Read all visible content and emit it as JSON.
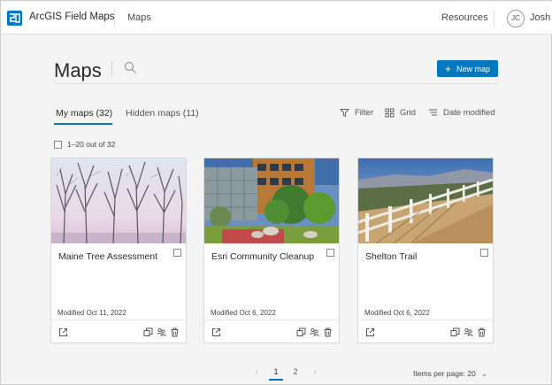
{
  "header": {
    "app_title": "ArcGIS Field Maps",
    "nav_maps": "Maps",
    "resources": "Resources",
    "avatar_initials": "JC",
    "username": "Josh"
  },
  "page": {
    "title": "Maps",
    "new_map_label": "New map",
    "accent_color": "#0079c1"
  },
  "tabs": [
    {
      "label": "My maps (32)",
      "active": true
    },
    {
      "label": "Hidden maps (11)",
      "active": false
    }
  ],
  "toolbar": {
    "filter": "Filter",
    "view": "Grid",
    "sort": "Date modified"
  },
  "selection": {
    "range_label": "1–20 out of 32"
  },
  "maps": [
    {
      "title": "Maine Tree Assessment",
      "modified": "Modified Oct 11, 2022"
    },
    {
      "title": "Esri Community Cleanup",
      "modified": "Modified Oct 6, 2022"
    },
    {
      "title": "Shelton Trail",
      "modified": "Modified Oct 6, 2022"
    }
  ],
  "pagination": {
    "prev": "‹",
    "pages": [
      "1",
      "2"
    ],
    "current": "1",
    "next": "›",
    "per_page_label": "Items per page: 20"
  }
}
